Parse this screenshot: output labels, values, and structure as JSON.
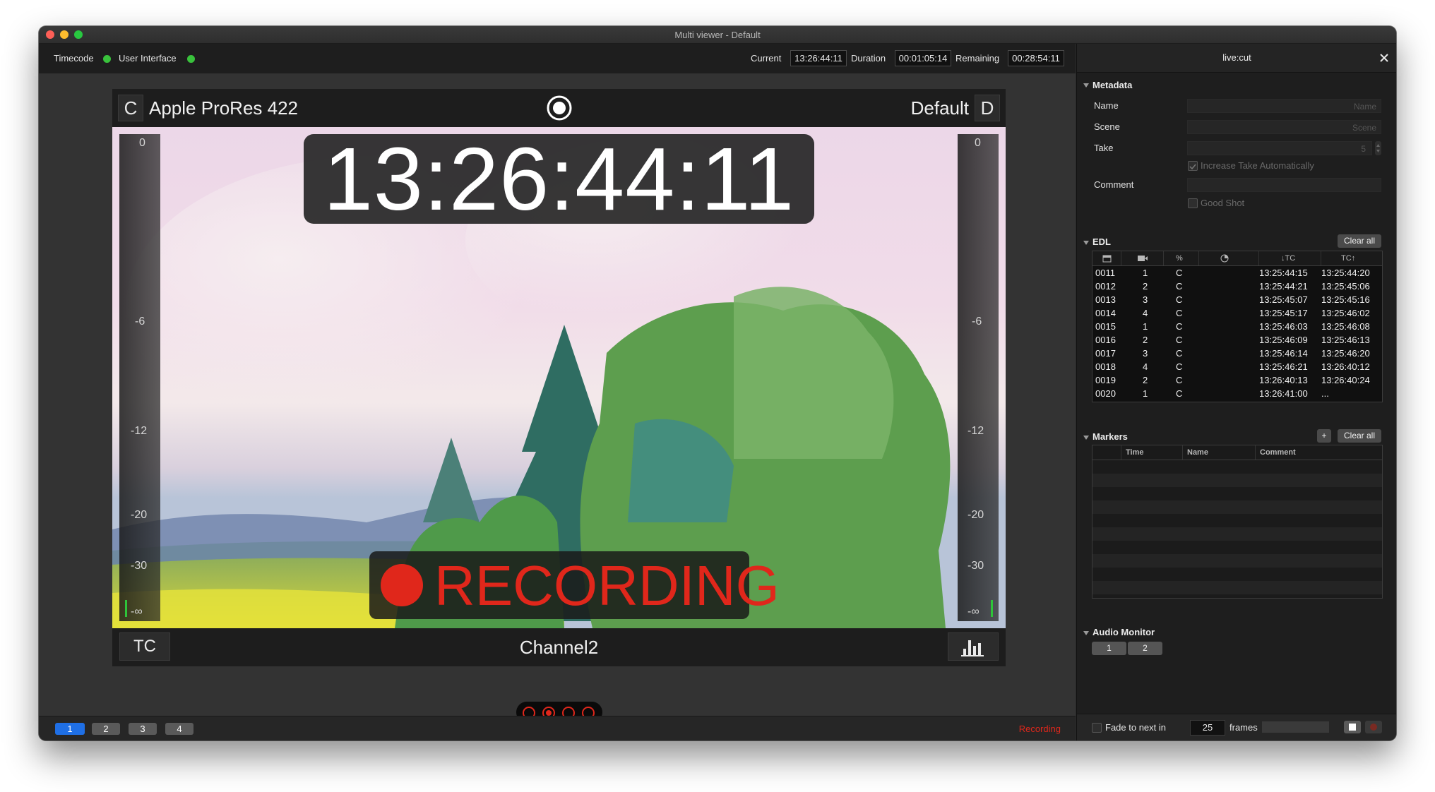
{
  "window": {
    "title": "Multi viewer - Default"
  },
  "toolbar": {
    "timecode_label": "Timecode",
    "ui_label": "User Interface",
    "current_label": "Current",
    "current_value": "13:26:44:11",
    "duration_label": "Duration",
    "duration_value": "00:01:05:14",
    "remaining_label": "Remaining",
    "remaining_value": "00:28:54:11"
  },
  "viewer": {
    "channel_letter": "C",
    "codec": "Apple ProRes 422",
    "preset": "Default",
    "preset_letter": "D",
    "timecode": "13:26:44:11",
    "recording_text": "RECORDING",
    "tc_button": "TC",
    "channel_name": "Channel2",
    "meter_labels": [
      "0",
      "-6",
      "-12",
      "-20",
      "-30",
      "-∞"
    ]
  },
  "channel_tabs": [
    "1",
    "2",
    "3",
    "4"
  ],
  "status": {
    "recording": "Recording"
  },
  "side": {
    "title": "live:cut",
    "metadata": {
      "heading": "Metadata",
      "name_label": "Name",
      "name_placeholder": "Name",
      "scene_label": "Scene",
      "scene_placeholder": "Scene",
      "take_label": "Take",
      "take_value": "5",
      "increase_take": "Increase Take Automatically",
      "comment_label": "Comment",
      "good_shot": "Good Shot"
    },
    "edl": {
      "heading": "EDL",
      "clear_label": "Clear all",
      "columns": [
        "",
        "",
        "%",
        "",
        "↓TC",
        "TC↑"
      ],
      "rows": [
        [
          "0011",
          "1",
          "C",
          "13:25:44:15",
          "13:25:44:20"
        ],
        [
          "0012",
          "2",
          "C",
          "13:25:44:21",
          "13:25:45:06"
        ],
        [
          "0013",
          "3",
          "C",
          "13:25:45:07",
          "13:25:45:16"
        ],
        [
          "0014",
          "4",
          "C",
          "13:25:45:17",
          "13:25:46:02"
        ],
        [
          "0015",
          "1",
          "C",
          "13:25:46:03",
          "13:25:46:08"
        ],
        [
          "0016",
          "2",
          "C",
          "13:25:46:09",
          "13:25:46:13"
        ],
        [
          "0017",
          "3",
          "C",
          "13:25:46:14",
          "13:25:46:20"
        ],
        [
          "0018",
          "4",
          "C",
          "13:25:46:21",
          "13:26:40:12"
        ],
        [
          "0019",
          "2",
          "C",
          "13:26:40:13",
          "13:26:40:24"
        ],
        [
          "0020",
          "1",
          "C",
          "13:26:41:00",
          "..."
        ]
      ]
    },
    "markers": {
      "heading": "Markers",
      "add_label": "+",
      "clear_label": "Clear all",
      "columns": [
        "Time",
        "Name",
        "Comment"
      ]
    },
    "audio": {
      "heading": "Audio Monitor",
      "channels": [
        "1",
        "2"
      ]
    },
    "footer": {
      "fade_label": "Fade to next in",
      "frames_value": "25",
      "frames_label": "frames"
    }
  },
  "colors": {
    "accent_blue": "#1f6fe5",
    "record_red": "#e0271b",
    "status_green": "#39c23c"
  }
}
